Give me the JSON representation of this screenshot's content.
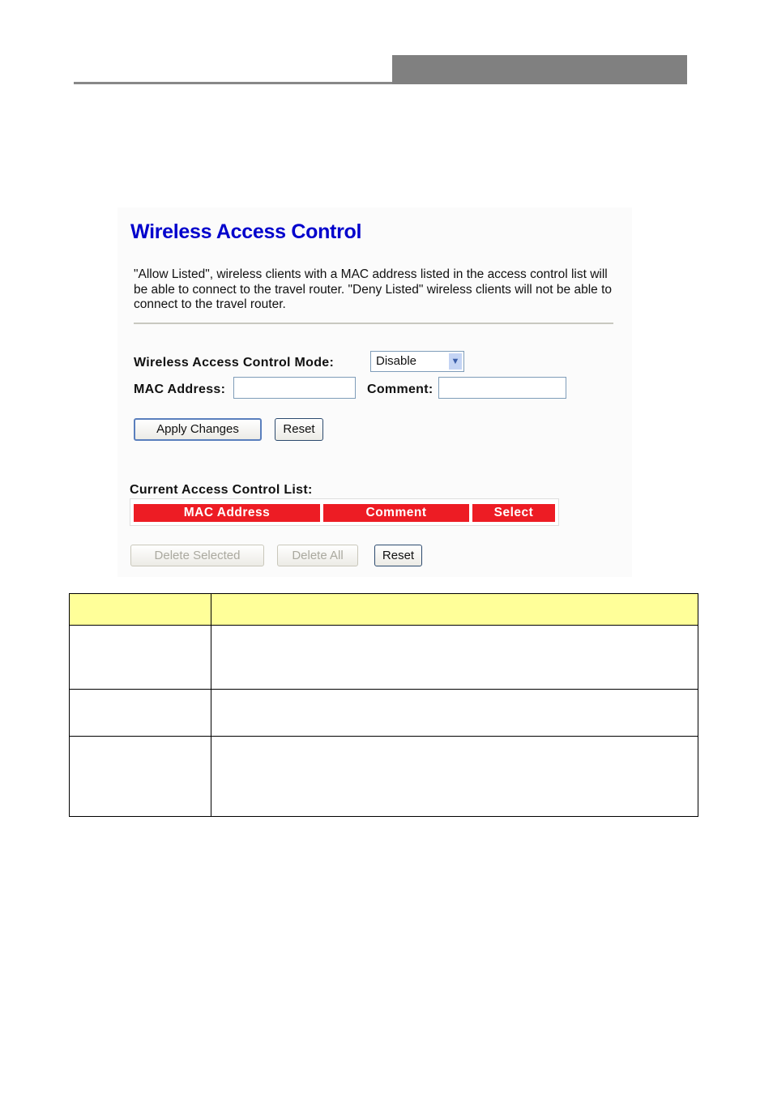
{
  "panel": {
    "title": "Wireless Access Control",
    "description": "\"Allow Listed\", wireless clients with a MAC address listed in the access control list will be able to connect to the travel router. \"Deny Listed\" wireless clients will not be able to connect to the travel router.",
    "mode_label": "Wireless Access Control Mode:",
    "mode_value": "Disable",
    "mac_label": "MAC Address:",
    "mac_value": "",
    "comment_label": "Comment:",
    "comment_value": "",
    "apply_label": "Apply Changes",
    "reset_label": "Reset",
    "list_title": "Current Access Control List:",
    "columns": [
      "MAC Address",
      "Comment",
      "Select"
    ],
    "delete_selected_label": "Delete Selected",
    "delete_all_label": "Delete All",
    "reset2_label": "Reset"
  },
  "colors": {
    "title": "#0000cc",
    "header_red": "#ed1c24",
    "table_header": "#ffff99",
    "banner": "#808080"
  }
}
